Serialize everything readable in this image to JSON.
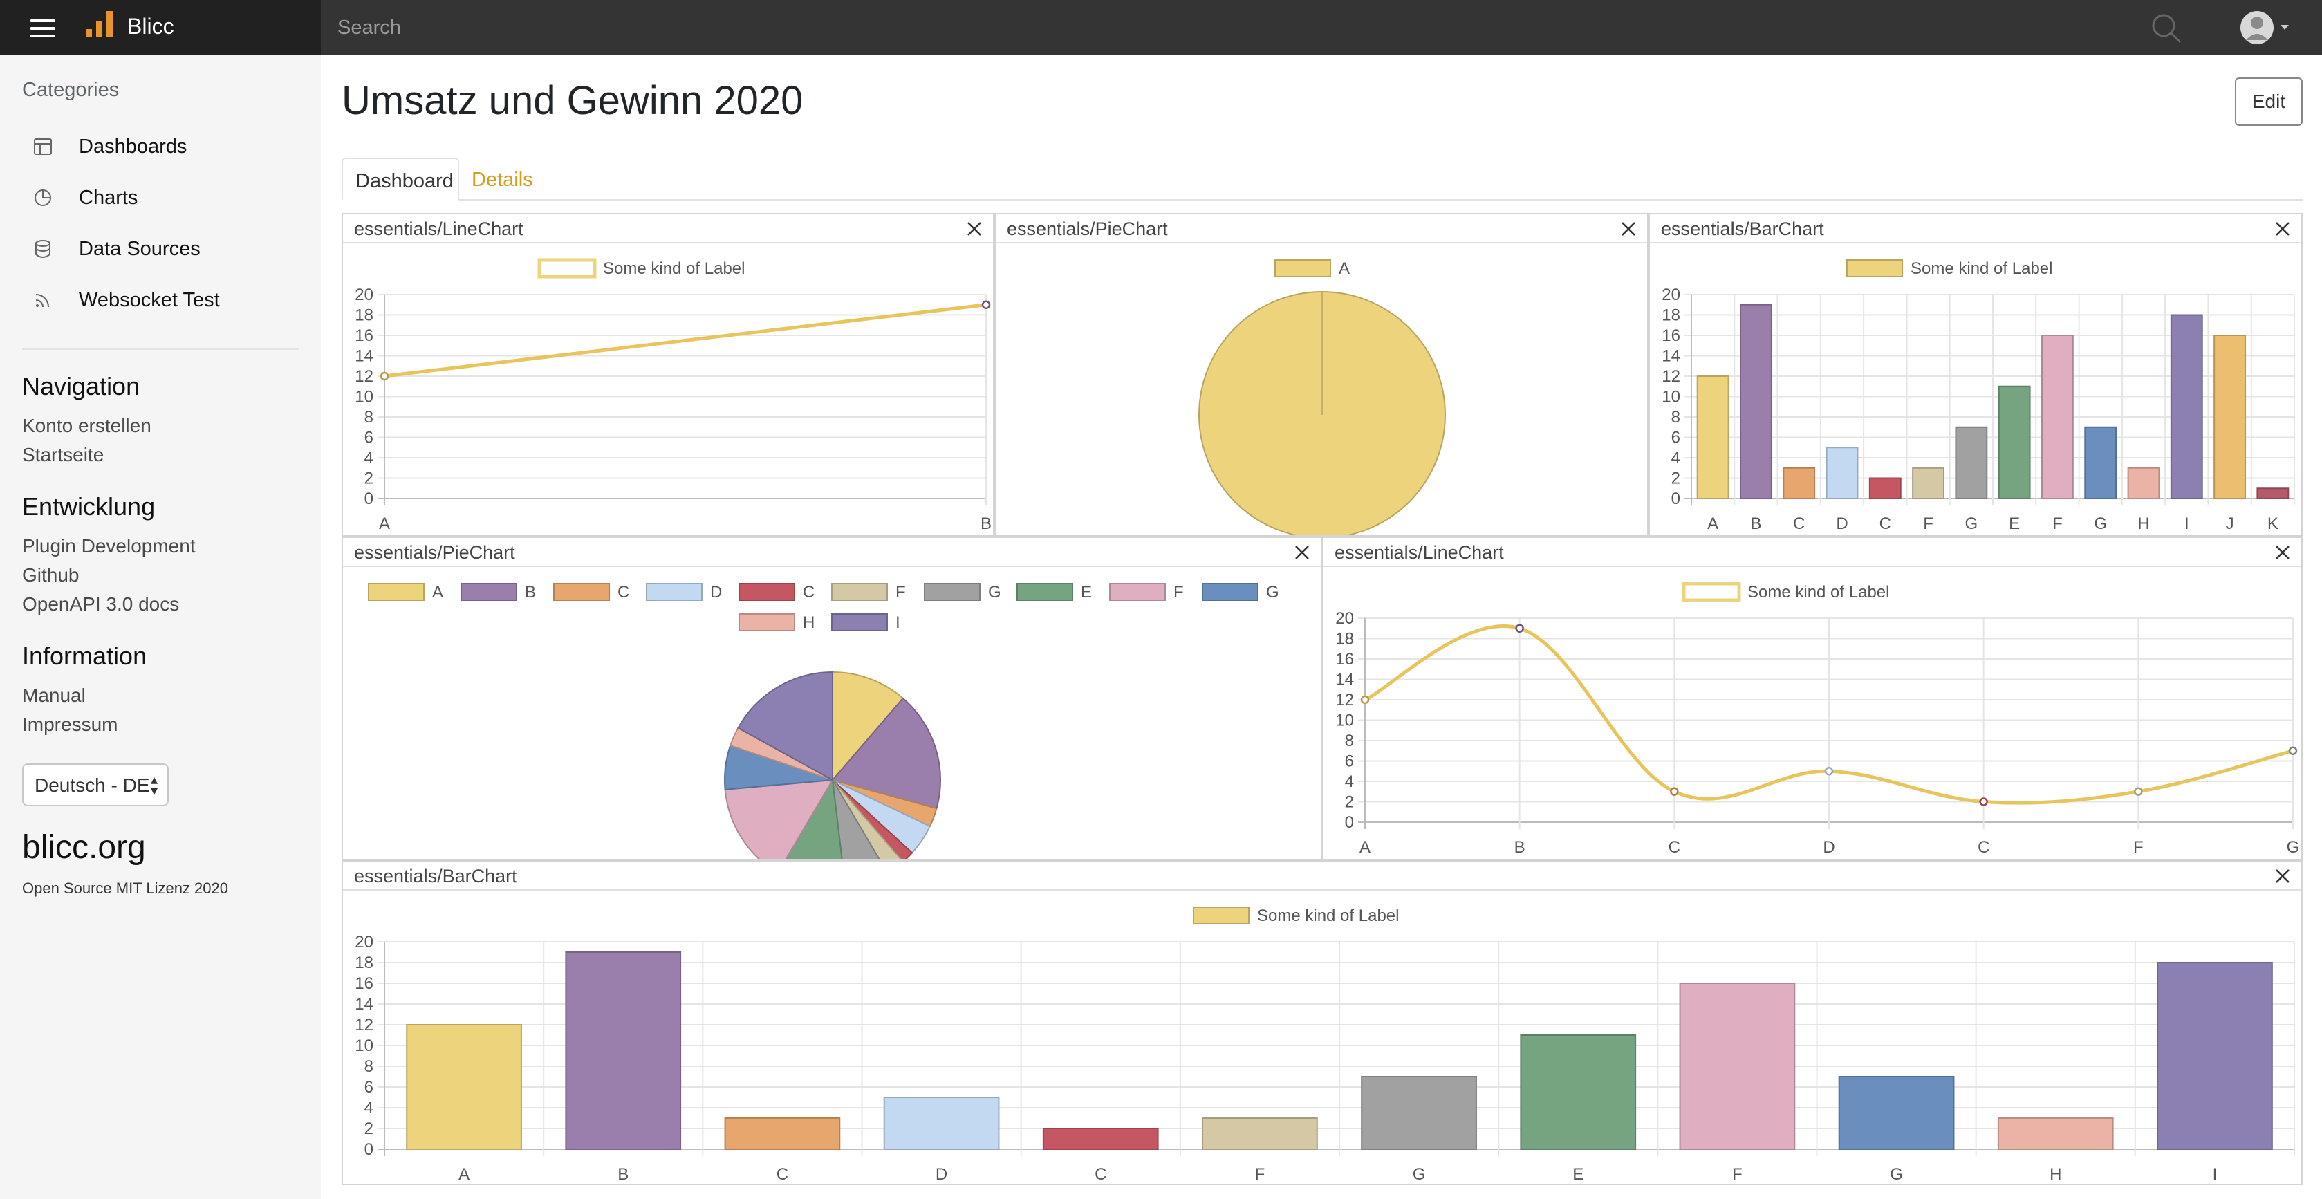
{
  "app": {
    "name": "Blicc"
  },
  "search": {
    "placeholder": "Search"
  },
  "sidebar": {
    "categories_title": "Categories",
    "items": [
      {
        "label": "Dashboards",
        "icon": "dashboard-icon"
      },
      {
        "label": "Charts",
        "icon": "pie-chart-icon"
      },
      {
        "label": "Data Sources",
        "icon": "database-icon"
      },
      {
        "label": "Websocket Test",
        "icon": "rss-icon"
      }
    ],
    "sections": [
      {
        "title": "Navigation",
        "links": [
          "Konto erstellen",
          "Startseite"
        ]
      },
      {
        "title": "Entwicklung",
        "links": [
          "Plugin Development",
          "Github",
          "OpenAPI 3.0 docs"
        ]
      },
      {
        "title": "Information",
        "links": [
          "Manual",
          "Impressum"
        ]
      }
    ],
    "language": "Deutsch - DE",
    "site": "blicc.org",
    "license": "Open Source MIT Lizenz 2020"
  },
  "main": {
    "title": "Umsatz und Gewinn 2020",
    "edit_label": "Edit",
    "tabs": [
      {
        "label": "Dashboard",
        "active": true
      },
      {
        "label": "Details",
        "active": false
      }
    ]
  },
  "colors": {
    "accent": "#d99a1c",
    "palette": [
      "#ecd37c",
      "#9a7fac",
      "#e6a66e",
      "#c3d8f1",
      "#c55763",
      "#d4c9a4",
      "#a1a1a1",
      "#76a481",
      "#dfaec0",
      "#6a8fbf",
      "#ebb3a6",
      "#8b80b1",
      "#ecbf70",
      "#b45b6b"
    ]
  },
  "panels": [
    {
      "title": "essentials/LineChart"
    },
    {
      "title": "essentials/PieChart"
    },
    {
      "title": "essentials/BarChart"
    },
    {
      "title": "essentials/PieChart"
    },
    {
      "title": "essentials/LineChart"
    },
    {
      "title": "essentials/BarChart"
    }
  ],
  "chart_data": [
    {
      "type": "line",
      "legend": [
        "Some kind of Label"
      ],
      "categories": [
        "A",
        "B"
      ],
      "series": [
        {
          "name": "Some kind of Label",
          "values": [
            12,
            19
          ]
        }
      ],
      "ylim": [
        0,
        20
      ],
      "yticks_step": 2,
      "grid": true,
      "legend_position": "top"
    },
    {
      "type": "pie",
      "legend": [
        "A"
      ],
      "categories": [
        "A"
      ],
      "values": [
        12
      ],
      "legend_position": "top"
    },
    {
      "type": "bar",
      "legend": [
        "Some kind of Label"
      ],
      "categories": [
        "A",
        "B",
        "C",
        "D",
        "C",
        "F",
        "G",
        "E",
        "F",
        "G",
        "H",
        "I",
        "J",
        "K"
      ],
      "series": [
        {
          "name": "Some kind of Label",
          "values": [
            12,
            19,
            3,
            5,
            2,
            3,
            7,
            11,
            16,
            7,
            3,
            18,
            16,
            1
          ]
        }
      ],
      "ylim": [
        0,
        20
      ],
      "yticks_step": 2,
      "grid": true,
      "legend_position": "top"
    },
    {
      "type": "pie",
      "legend": [
        "A",
        "B",
        "C",
        "D",
        "C",
        "F",
        "G",
        "E",
        "F",
        "G",
        "H",
        "I"
      ],
      "categories": [
        "A",
        "B",
        "C",
        "D",
        "C",
        "F",
        "G",
        "E",
        "F",
        "G",
        "H",
        "I"
      ],
      "values": [
        12,
        19,
        3,
        5,
        2,
        3,
        7,
        11,
        16,
        7,
        3,
        18
      ],
      "legend_position": "top"
    },
    {
      "type": "line",
      "legend": [
        "Some kind of Label"
      ],
      "categories": [
        "A",
        "B",
        "C",
        "D",
        "C",
        "F",
        "G"
      ],
      "series": [
        {
          "name": "Some kind of Label",
          "values": [
            12,
            19,
            3,
            5,
            2,
            3,
            7
          ]
        }
      ],
      "ylim": [
        0,
        20
      ],
      "yticks_step": 2,
      "grid": true,
      "smooth": true,
      "legend_position": "top"
    },
    {
      "type": "bar",
      "legend": [
        "Some kind of Label"
      ],
      "categories": [
        "A",
        "B",
        "C",
        "D",
        "C",
        "F",
        "G",
        "E",
        "F",
        "G",
        "H",
        "I"
      ],
      "series": [
        {
          "name": "Some kind of Label",
          "values": [
            12,
            19,
            3,
            5,
            2,
            3,
            7,
            11,
            16,
            7,
            3,
            18
          ]
        }
      ],
      "ylim": [
        0,
        20
      ],
      "yticks_step": 2,
      "grid": true,
      "legend_position": "top"
    }
  ]
}
